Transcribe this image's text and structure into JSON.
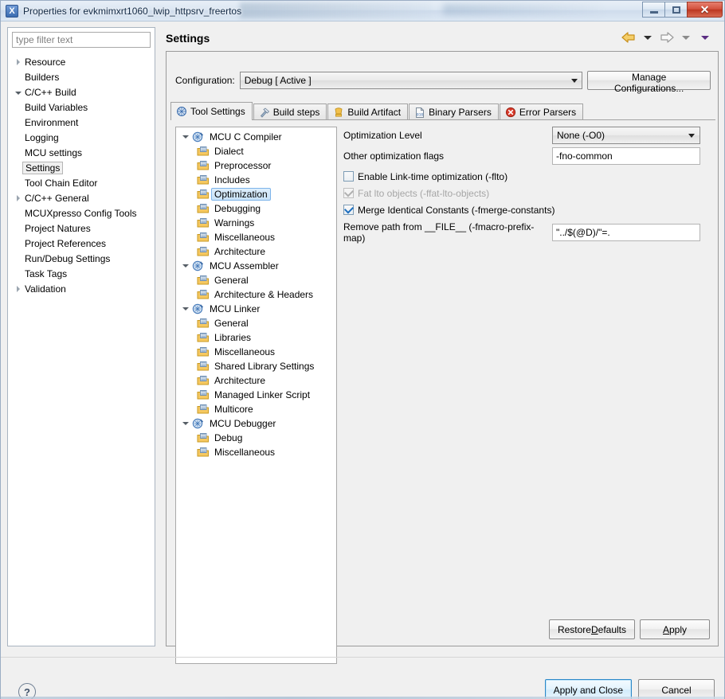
{
  "window": {
    "title": "Properties for evkmimxrt1060_lwip_httpsrv_freertos",
    "app_icon": "x-square-icon",
    "buttons": {
      "minimize": "minimize-icon",
      "restore": "restore-icon",
      "close": "close-icon"
    }
  },
  "filter": {
    "placeholder": "type filter text",
    "value": ""
  },
  "nav_tree": [
    {
      "label": "Resource",
      "indent": 0,
      "twisty": "collapsed",
      "selected": false
    },
    {
      "label": "Builders",
      "indent": 0,
      "twisty": "none",
      "selected": false
    },
    {
      "label": "C/C++ Build",
      "indent": 0,
      "twisty": "expanded",
      "selected": false
    },
    {
      "label": "Build Variables",
      "indent": 1,
      "twisty": "none",
      "selected": false
    },
    {
      "label": "Environment",
      "indent": 1,
      "twisty": "none",
      "selected": false
    },
    {
      "label": "Logging",
      "indent": 1,
      "twisty": "none",
      "selected": false
    },
    {
      "label": "MCU settings",
      "indent": 1,
      "twisty": "none",
      "selected": false
    },
    {
      "label": "Settings",
      "indent": 1,
      "twisty": "none",
      "selected": true
    },
    {
      "label": "Tool Chain Editor",
      "indent": 1,
      "twisty": "none",
      "selected": false
    },
    {
      "label": "C/C++ General",
      "indent": 0,
      "twisty": "collapsed",
      "selected": false
    },
    {
      "label": "MCUXpresso Config Tools",
      "indent": 0,
      "twisty": "none",
      "selected": false
    },
    {
      "label": "Project Natures",
      "indent": 0,
      "twisty": "none",
      "selected": false
    },
    {
      "label": "Project References",
      "indent": 0,
      "twisty": "none",
      "selected": false
    },
    {
      "label": "Run/Debug Settings",
      "indent": 0,
      "twisty": "none",
      "selected": false
    },
    {
      "label": "Task Tags",
      "indent": 0,
      "twisty": "none",
      "selected": false
    },
    {
      "label": "Validation",
      "indent": 0,
      "twisty": "collapsed",
      "selected": false
    }
  ],
  "page": {
    "title": "Settings",
    "nav": {
      "back_icon": "back-arrow-icon",
      "back_menu_icon": "chevron-down-icon",
      "forward_icon": "forward-arrow-icon",
      "forward_menu_icon": "chevron-down-icon",
      "view_menu_icon": "chevron-down-icon"
    }
  },
  "configuration": {
    "label": "Configuration:",
    "value": "Debug  [ Active ]",
    "dropdown_icon": "chevron-down-icon",
    "manage_button": "Manage Configurations..."
  },
  "tabs": [
    {
      "label": "Tool Settings",
      "icon": "tool-settings-icon",
      "active": true
    },
    {
      "label": "Build steps",
      "icon": "build-steps-icon",
      "active": false
    },
    {
      "label": "Build Artifact",
      "icon": "build-artifact-icon",
      "active": false
    },
    {
      "label": "Binary Parsers",
      "icon": "binary-parsers-icon",
      "active": false
    },
    {
      "label": "Error Parsers",
      "icon": "error-parsers-icon",
      "active": false
    }
  ],
  "tool_tree": [
    {
      "label": "MCU C Compiler",
      "level": 0,
      "icon": "tool-icon",
      "selected": false
    },
    {
      "label": "Dialect",
      "level": 1,
      "icon": "folder-icon",
      "selected": false
    },
    {
      "label": "Preprocessor",
      "level": 1,
      "icon": "folder-icon",
      "selected": false
    },
    {
      "label": "Includes",
      "level": 1,
      "icon": "folder-icon",
      "selected": false
    },
    {
      "label": "Optimization",
      "level": 1,
      "icon": "folder-icon",
      "selected": true
    },
    {
      "label": "Debugging",
      "level": 1,
      "icon": "folder-icon",
      "selected": false
    },
    {
      "label": "Warnings",
      "level": 1,
      "icon": "folder-icon",
      "selected": false
    },
    {
      "label": "Miscellaneous",
      "level": 1,
      "icon": "folder-icon",
      "selected": false
    },
    {
      "label": "Architecture",
      "level": 1,
      "icon": "folder-icon",
      "selected": false
    },
    {
      "label": "MCU Assembler",
      "level": 0,
      "icon": "tool-icon",
      "selected": false
    },
    {
      "label": "General",
      "level": 1,
      "icon": "folder-icon",
      "selected": false
    },
    {
      "label": "Architecture & Headers",
      "level": 1,
      "icon": "folder-icon",
      "selected": false
    },
    {
      "label": "MCU Linker",
      "level": 0,
      "icon": "tool-icon",
      "selected": false
    },
    {
      "label": "General",
      "level": 1,
      "icon": "folder-icon",
      "selected": false
    },
    {
      "label": "Libraries",
      "level": 1,
      "icon": "folder-icon",
      "selected": false
    },
    {
      "label": "Miscellaneous",
      "level": 1,
      "icon": "folder-icon",
      "selected": false
    },
    {
      "label": "Shared Library Settings",
      "level": 1,
      "icon": "folder-icon",
      "selected": false
    },
    {
      "label": "Architecture",
      "level": 1,
      "icon": "folder-icon",
      "selected": false
    },
    {
      "label": "Managed Linker Script",
      "level": 1,
      "icon": "folder-icon",
      "selected": false
    },
    {
      "label": "Multicore",
      "level": 1,
      "icon": "folder-icon",
      "selected": false
    },
    {
      "label": "MCU Debugger",
      "level": 0,
      "icon": "tool-icon",
      "selected": false
    },
    {
      "label": "Debug",
      "level": 1,
      "icon": "folder-icon",
      "selected": false
    },
    {
      "label": "Miscellaneous",
      "level": 1,
      "icon": "folder-icon",
      "selected": false
    }
  ],
  "options": {
    "optimization_level": {
      "label": "Optimization Level",
      "value": "None (-O0)",
      "dropdown_icon": "chevron-down-icon"
    },
    "other_flags": {
      "label": "Other optimization flags",
      "value": "-fno-common"
    },
    "enable_lto": {
      "label": "Enable Link-time optimization (-flto)",
      "checked": false,
      "enabled": true
    },
    "fat_lto": {
      "label": "Fat lto objects (-ffat-lto-objects)",
      "checked": true,
      "enabled": false
    },
    "merge_constants": {
      "label": "Merge Identical Constants (-fmerge-constants)",
      "checked": true,
      "enabled": true
    },
    "macro_prefix_map": {
      "label": "Remove path from __FILE__ (-fmacro-prefix-map)",
      "value": "\"../$(@D)/\"=."
    }
  },
  "settings_buttons": {
    "restore_defaults_pre": "Restore ",
    "restore_defaults_acc": "D",
    "restore_defaults_post": "efaults",
    "apply_acc": "A",
    "apply_post": "pply"
  },
  "footer": {
    "help_icon": "help-icon",
    "apply_and_close": "Apply and Close",
    "cancel": "Cancel"
  },
  "colors": {
    "accent_blue": "#2c89c9",
    "selection_blue": "#7eb4ea",
    "close_red": "#bb3520",
    "back_arrow_orange": "#e8a317",
    "dialog_bg": "#f0f0f0"
  }
}
